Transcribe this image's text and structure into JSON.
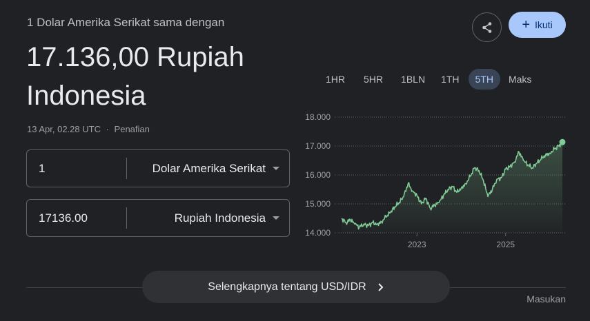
{
  "header": {
    "subtitle": "1 Dolar Amerika Serikat sama dengan",
    "value": "17.136,00 Rupiah Indonesia",
    "timestamp": "13 Apr, 02.28 UTC",
    "separator": "·",
    "disclaimer": "Penafian"
  },
  "converter": {
    "from_amount": "1",
    "from_currency": "Dolar Amerika Serikat",
    "to_amount": "17136.00",
    "to_currency": "Rupiah Indonesia"
  },
  "actions": {
    "follow_label": "Ikuti",
    "share_icon": "share-icon",
    "plus_icon": "plus-icon"
  },
  "ranges": [
    {
      "label": "1HR",
      "active": false
    },
    {
      "label": "5HR",
      "active": false
    },
    {
      "label": "1BLN",
      "active": false
    },
    {
      "label": "1TH",
      "active": false
    },
    {
      "label": "5TH",
      "active": true
    },
    {
      "label": "Maks",
      "active": false
    }
  ],
  "footer": {
    "more_label": "Selengkapnya tentang USD/IDR",
    "feedback": "Masukan"
  },
  "colors": {
    "line": "#81c995",
    "accent": "#a8c7fa"
  },
  "chart_data": {
    "type": "line",
    "ylim": [
      14000,
      18000
    ],
    "y_ticks": [
      "14.000",
      "15.000",
      "16.000",
      "17.000",
      "18.000"
    ],
    "x_ticks": [
      {
        "label": "2023",
        "x": 2023.0
      },
      {
        "label": "2025",
        "x": 2025.0
      }
    ],
    "series": [
      {
        "x": [
          2021.3,
          2021.4,
          2021.5,
          2021.6,
          2021.7,
          2021.8,
          2021.9,
          2022.0,
          2022.1,
          2022.2,
          2022.3,
          2022.4,
          2022.5,
          2022.6,
          2022.7,
          2022.8,
          2022.9,
          2023.0,
          2023.1,
          2023.2,
          2023.3,
          2023.4,
          2023.5,
          2023.6,
          2023.7,
          2023.8,
          2023.9,
          2024.0,
          2024.1,
          2024.2,
          2024.3,
          2024.4,
          2024.5,
          2024.6,
          2024.7,
          2024.8,
          2024.9,
          2025.0,
          2025.1,
          2025.2,
          2025.3,
          2025.4,
          2025.5,
          2025.6,
          2025.7,
          2025.8,
          2025.9,
          2026.0,
          2026.1,
          2026.2,
          2026.28
        ],
        "values": [
          14500,
          14350,
          14450,
          14300,
          14200,
          14300,
          14250,
          14350,
          14300,
          14380,
          14550,
          14700,
          14900,
          15050,
          15250,
          15700,
          15450,
          15300,
          15000,
          15200,
          14850,
          14950,
          15050,
          15300,
          15500,
          15600,
          15400,
          15550,
          15700,
          15950,
          16250,
          16150,
          15800,
          15250,
          15500,
          15850,
          15900,
          16200,
          16300,
          16450,
          16800,
          16500,
          16350,
          16250,
          16400,
          16550,
          16700,
          16750,
          16900,
          17000,
          17136
        ]
      }
    ]
  }
}
